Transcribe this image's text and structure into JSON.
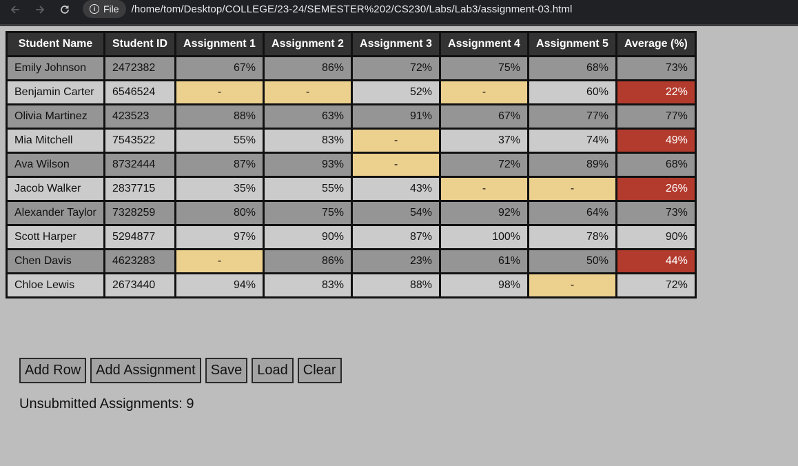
{
  "browser": {
    "file_label": "File",
    "url": "/home/tom/Desktop/COLLEGE/23-24/SEMESTER%202/CS230/Labs/Lab3/assignment-03.html"
  },
  "table": {
    "headers": [
      "Student Name",
      "Student ID",
      "Assignment 1",
      "Assignment 2",
      "Assignment 3",
      "Assignment 4",
      "Assignment 5",
      "Average (%)"
    ],
    "rows": [
      {
        "name": "Emily Johnson",
        "id": "2472382",
        "grades": [
          "67%",
          "86%",
          "72%",
          "75%",
          "68%"
        ],
        "average": "73%"
      },
      {
        "name": "Benjamin Carter",
        "id": "6546524",
        "grades": [
          "-",
          "-",
          "52%",
          "-",
          "60%"
        ],
        "average": "22%"
      },
      {
        "name": "Olivia Martinez",
        "id": "423523",
        "grades": [
          "88%",
          "63%",
          "91%",
          "67%",
          "77%"
        ],
        "average": "77%"
      },
      {
        "name": "Mia Mitchell",
        "id": "7543522",
        "grades": [
          "55%",
          "83%",
          "-",
          "37%",
          "74%"
        ],
        "average": "49%"
      },
      {
        "name": "Ava Wilson",
        "id": "8732444",
        "grades": [
          "87%",
          "93%",
          "-",
          "72%",
          "89%"
        ],
        "average": "68%"
      },
      {
        "name": "Jacob Walker",
        "id": "2837715",
        "grades": [
          "35%",
          "55%",
          "43%",
          "-",
          "-"
        ],
        "average": "26%"
      },
      {
        "name": "Alexander Taylor",
        "id": "7328259",
        "grades": [
          "80%",
          "75%",
          "54%",
          "92%",
          "64%"
        ],
        "average": "73%"
      },
      {
        "name": "Scott Harper",
        "id": "5294877",
        "grades": [
          "97%",
          "90%",
          "87%",
          "100%",
          "78%"
        ],
        "average": "90%"
      },
      {
        "name": "Chen Davis",
        "id": "4623283",
        "grades": [
          "-",
          "86%",
          "23%",
          "61%",
          "50%"
        ],
        "average": "44%"
      },
      {
        "name": "Chloe Lewis",
        "id": "2673440",
        "grades": [
          "94%",
          "83%",
          "88%",
          "98%",
          "-"
        ],
        "average": "72%"
      }
    ]
  },
  "actions": {
    "add_row": "Add Row",
    "add_assignment": "Add Assignment",
    "save": "Save",
    "load": "Load",
    "clear": "Clear"
  },
  "status": {
    "unsubmitted_label": "Unsubmitted Assignments: 9"
  },
  "colors": {
    "missing": "#ecd08e",
    "failing_average": "#b33b2e",
    "header": "#333333",
    "row_dark": "#959595",
    "row_light": "#cbcbcb"
  }
}
